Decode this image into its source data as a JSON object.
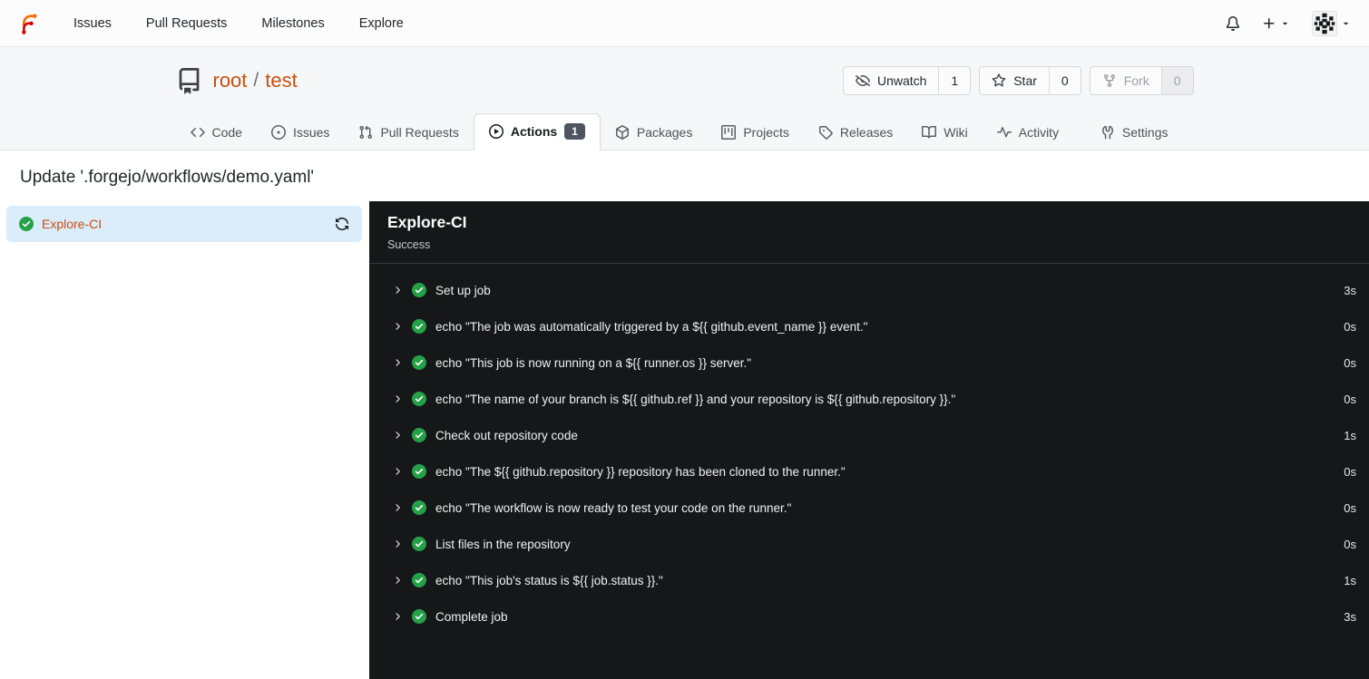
{
  "colors": {
    "primary_link": "#c9500e",
    "success_green": "#24a148",
    "panel_bg": "#161719",
    "job_selected_bg": "#dbecfb",
    "actions_badge_bg": "#4e5561"
  },
  "navbar": {
    "links": [
      "Issues",
      "Pull Requests",
      "Milestones",
      "Explore"
    ]
  },
  "repo": {
    "owner": "root",
    "separator": "/",
    "name": "test"
  },
  "repo_actions": {
    "unwatch": {
      "label": "Unwatch",
      "count": "1"
    },
    "star": {
      "label": "Star",
      "count": "0"
    },
    "fork": {
      "label": "Fork",
      "count": "0"
    }
  },
  "tabs": [
    {
      "label": "Code"
    },
    {
      "label": "Issues"
    },
    {
      "label": "Pull Requests"
    },
    {
      "label": "Actions",
      "badge": "1"
    },
    {
      "label": "Packages"
    },
    {
      "label": "Projects"
    },
    {
      "label": "Releases"
    },
    {
      "label": "Wiki"
    },
    {
      "label": "Activity"
    },
    {
      "label": "Settings"
    }
  ],
  "run": {
    "title": "Update '.forgejo/workflows/demo.yaml'",
    "job": {
      "name": "Explore-CI"
    },
    "panel": {
      "job_name": "Explore-CI",
      "status": "Success",
      "steps": [
        {
          "name": "Set up job",
          "duration": "3s"
        },
        {
          "name": "echo \"The job was automatically triggered by a ${{ github.event_name }} event.\"",
          "duration": "0s"
        },
        {
          "name": "echo \"This job is now running on a ${{ runner.os }} server.\"",
          "duration": "0s"
        },
        {
          "name": "echo \"The name of your branch is ${{ github.ref }} and your repository is ${{ github.repository }}.\"",
          "duration": "0s"
        },
        {
          "name": "Check out repository code",
          "duration": "1s"
        },
        {
          "name": "echo \"The ${{ github.repository }} repository has been cloned to the runner.\"",
          "duration": "0s"
        },
        {
          "name": "echo \"The workflow is now ready to test your code on the runner.\"",
          "duration": "0s"
        },
        {
          "name": "List files in the repository",
          "duration": "0s"
        },
        {
          "name": "echo \"This job's status is ${{ job.status }}.\"",
          "duration": "1s"
        },
        {
          "name": "Complete job",
          "duration": "3s"
        }
      ]
    }
  }
}
